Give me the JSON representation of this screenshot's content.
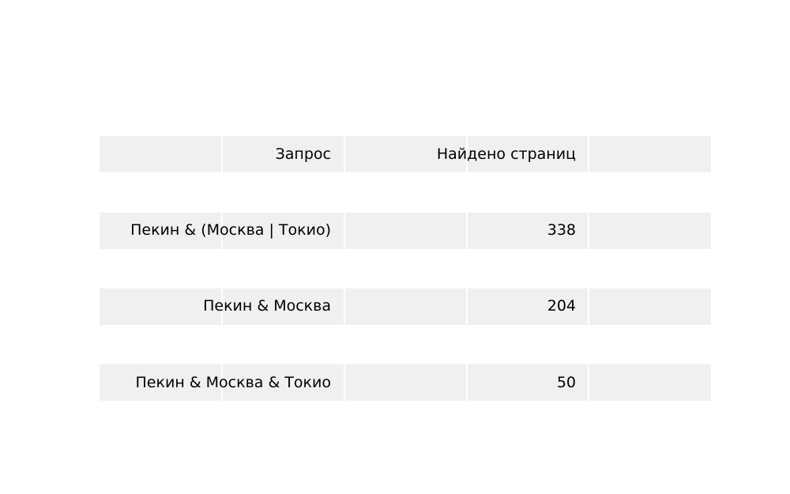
{
  "chart_data": {
    "type": "table",
    "columns": [
      "Запрос",
      "Найдено страниц"
    ],
    "rows": [
      [
        "Пекин & (Москва | Токио)",
        "338"
      ],
      [
        "Пекин & Москва",
        "204"
      ],
      [
        "Пекин & Москва & Токио",
        "50"
      ]
    ],
    "colors": {
      "row_background": "#f0f0f0",
      "divider": "#ffffff",
      "text": "#000000"
    }
  }
}
